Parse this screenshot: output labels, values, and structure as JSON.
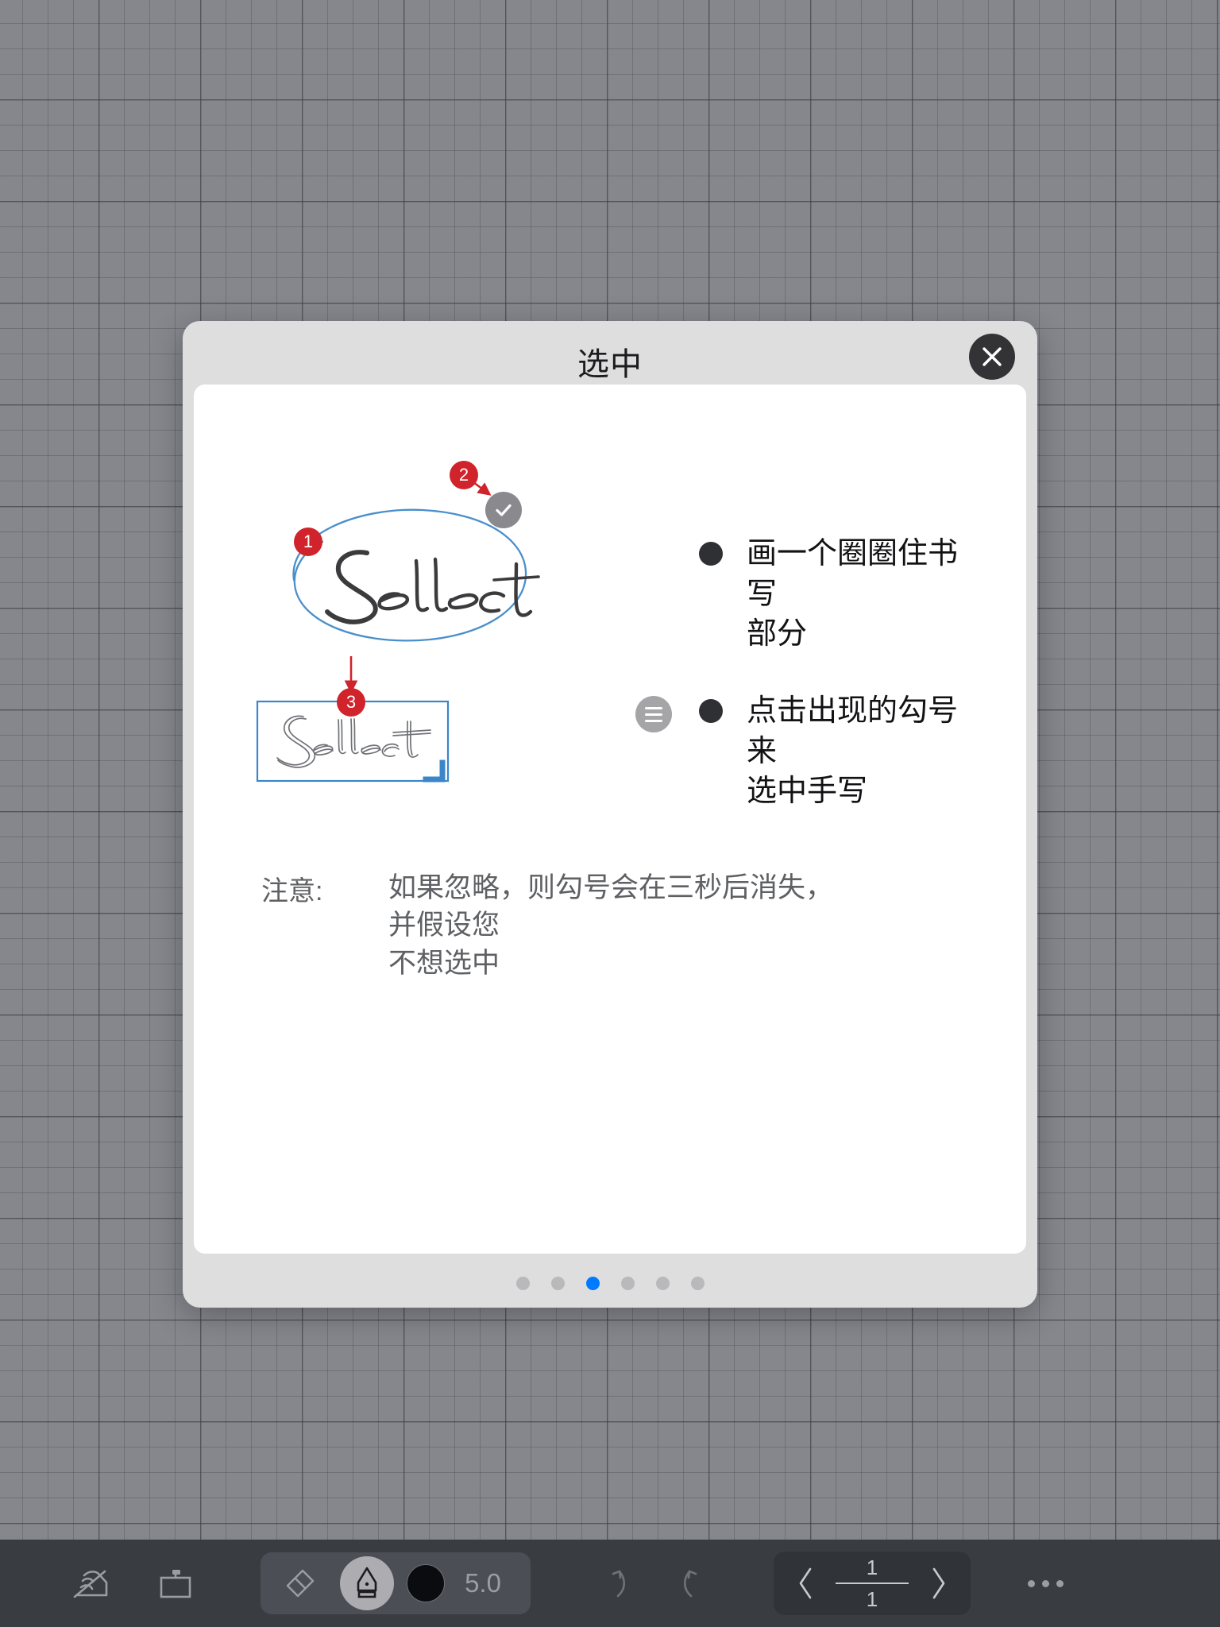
{
  "dialog": {
    "title": "选中",
    "close_icon": "close-icon",
    "steps": [
      {
        "badge": "1",
        "icon": "lasso-ellipse",
        "word": "Select"
      },
      {
        "badge": "2",
        "icon": "check-circle-icon"
      },
      {
        "badge": "3",
        "icon": "selection-box",
        "word": "Select"
      }
    ],
    "instructions": [
      {
        "bullet": "•",
        "text": "画一个圈圈住书写\n部分"
      },
      {
        "bullet": "•",
        "text": "点击出现的勾号来\n选中手写",
        "side_icon": "hamburger-menu-icon"
      }
    ],
    "note": {
      "label": "注意:",
      "text": "如果忽略，则勾号会在三秒后消失，并假设您\n不想选中"
    },
    "pagination": {
      "total": 6,
      "active_index": 2
    }
  },
  "toolbar": {
    "handwriting_icon": "handwriting-pen-icon",
    "page_frame_icon": "page-frame-icon",
    "eraser_icon": "eraser-icon",
    "pen_icon": "fountain-pen-icon",
    "color_swatch": "#0b0c10",
    "brush_size": "5.0",
    "undo_icon": "undo-icon",
    "redo_icon": "redo-icon",
    "prev_page_icon": "chevron-left-icon",
    "next_page_icon": "chevron-right-icon",
    "page_current": "1",
    "page_total": "1",
    "more_icon": "more-ellipsis-icon"
  },
  "colors": {
    "accent": "#007aff",
    "badge_red": "#d0232b",
    "selection_blue": "#3a86c8",
    "canvas_grid": "#85878d",
    "toolbar_bg": "#393c41"
  }
}
